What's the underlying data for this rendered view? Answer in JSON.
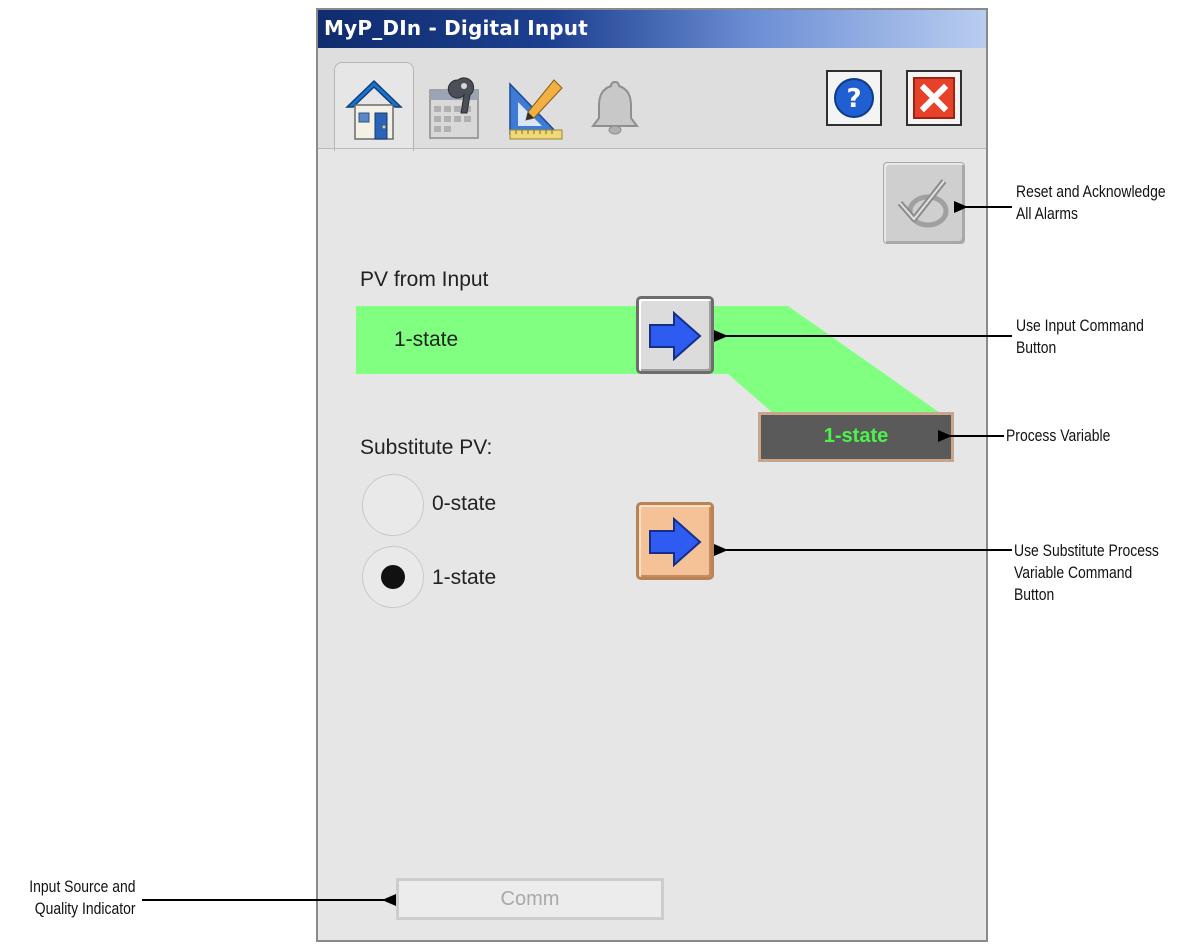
{
  "window": {
    "title": "MyP_DIn - Digital Input"
  },
  "tabs": [
    {
      "name": "home-icon",
      "active": true
    },
    {
      "name": "maintenance-icon",
      "active": false
    },
    {
      "name": "engineering-icon",
      "active": false
    },
    {
      "name": "alarm-bell-icon",
      "active": false
    }
  ],
  "toolbar": {
    "help_icon": "help-icon",
    "close_icon": "close-icon"
  },
  "operator": {
    "pv_from_input_label": "PV from Input",
    "pv_from_input_value": "1-state",
    "pv_display_value": "1-state",
    "substitute_pv_label": "Substitute PV:",
    "radio_options": [
      {
        "label": "0-state",
        "selected": false
      },
      {
        "label": "1-state",
        "selected": true
      }
    ],
    "source_quality": "Comm"
  },
  "annotations": {
    "reset_ack_line1": "Reset and Acknowledge",
    "reset_ack_line2": "All Alarms",
    "use_input_line1": "Use Input Command",
    "use_input_line2": "Button",
    "process_variable": "Process Variable",
    "use_sub_line1": "Use Substitute Process",
    "use_sub_line2": "Variable Command",
    "use_sub_line3": "Button",
    "source_line1": "Input Source and",
    "source_line2": "Quality Indicator"
  },
  "colors": {
    "pv_band": "#80ff80",
    "pv_text": "#4cf24c",
    "substitute_button": "#f5c298",
    "close_button": "#e8412a",
    "help_button": "#1f5fd1"
  }
}
